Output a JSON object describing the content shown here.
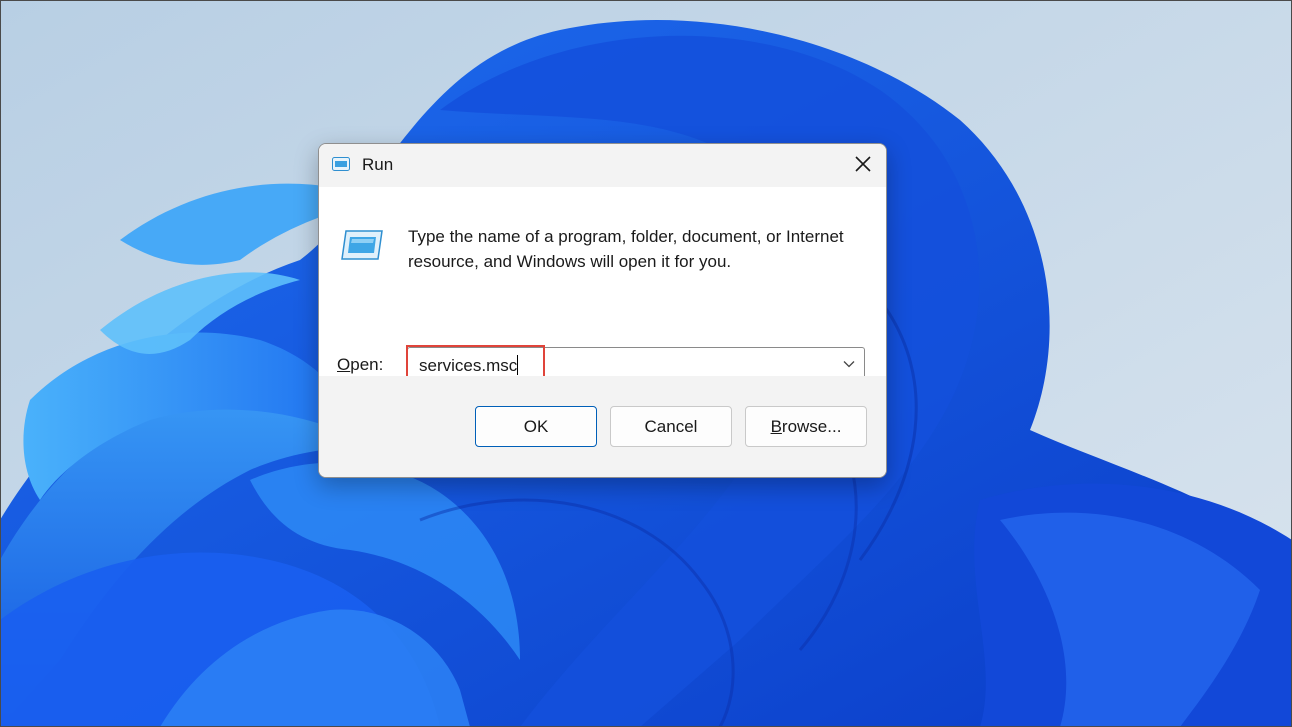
{
  "dialog": {
    "title": "Run",
    "close_icon": "close-icon",
    "app_icon": "run-icon",
    "description": "Type the name of a program, folder, document, or Internet resource, and Windows will open it for you.",
    "open_label_key": "O",
    "open_label_rest": "pen:",
    "input_value": "services.msc",
    "dropdown_icon": "chevron-down-icon",
    "ok_label": "OK",
    "cancel_label": "Cancel",
    "browse_label_key": "B",
    "browse_label_rest": "rowse...",
    "highlight_color": "#e0443a",
    "accent": "#005fb8"
  }
}
